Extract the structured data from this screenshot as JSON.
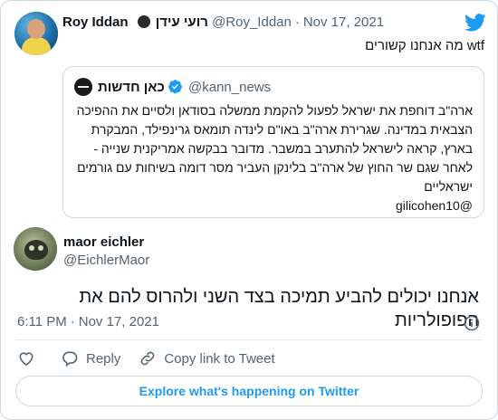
{
  "parent_tweet": {
    "author_name": "Roy Iddan",
    "author_name_he": "רועי עידן",
    "handle": "@Roy_Iddan",
    "separator": "·",
    "date": "Nov 17, 2021",
    "text": "wtf מה אנחנו קשורים"
  },
  "quoted_tweet": {
    "author_name": "כאן חדשות",
    "handle": "@kann_news",
    "lines": [
      "ארה\"ב דוחפת את ישראל לפעול להקמת ממשלה בסודאן ולסיים את ההפיכה",
      "הצבאית במדינה. שגרירת ארה\"ב באו\"ם לינדה תומאס גרינפילד, המבקרת",
      "בארץ, קראה לישראל להתערב במשבר. מדובר בבקשה אמריקנית שנייה -",
      "לאחר שגם שר החוץ של ארה\"ב בלינקן העביר מסר דומה בשיחות עם גורמים",
      "ישראליים",
      "@gilicohen10"
    ]
  },
  "main_tweet": {
    "author_name": "maor eichler",
    "handle": "@EichlerMaor",
    "text": "אנחנו יכולים להביע תמיכה בצד השני ולהרוס להם את הפופולריות",
    "time": "6:11 PM",
    "separator": "·",
    "date": "Nov 17, 2021"
  },
  "actions": {
    "reply_label": "Reply",
    "copy_link_label": "Copy link to Tweet"
  },
  "explore_label": "Explore what's happening on Twitter",
  "colors": {
    "accent": "#1d9bf0",
    "muted": "#536471",
    "border": "#cfd9de"
  },
  "icons": [
    "twitter-bird-icon",
    "verified-icon",
    "info-icon",
    "heart-icon",
    "reply-icon",
    "link-icon"
  ]
}
